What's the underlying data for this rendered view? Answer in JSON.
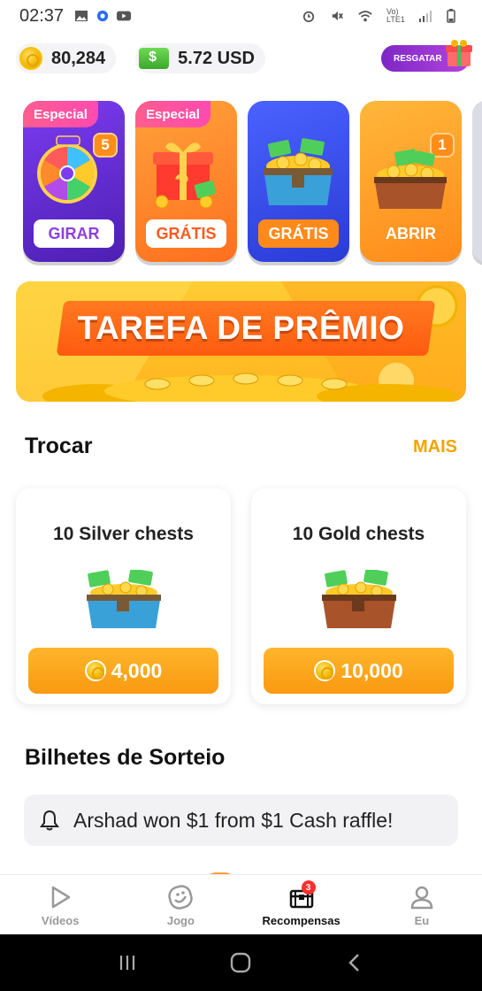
{
  "statusbar": {
    "time": "02:37",
    "network_label": "Vo) LTE1"
  },
  "balances": {
    "coins": "80,284",
    "cash": "5.72 USD",
    "redeem_label": "RESGATAR"
  },
  "reward_cards": [
    {
      "tag": "Especial",
      "badge": "5",
      "button": "GIRAR",
      "icon": "wheel-icon"
    },
    {
      "tag": "Especial",
      "badge": "",
      "button": "GRÁTIS",
      "icon": "gift-box-icon"
    },
    {
      "tag": "",
      "badge": "",
      "button": "GRÁTIS",
      "icon": "silver-chest-icon"
    },
    {
      "tag": "",
      "badge": "1",
      "button": "ABRIR",
      "icon": "gold-chest-icon"
    }
  ],
  "banner": {
    "title": "TAREFA DE PRÊMIO"
  },
  "trade": {
    "title": "Trocar",
    "more": "MAIS",
    "items": [
      {
        "title": "10 Silver chests",
        "price": "4,000",
        "icon": "silver-chest-icon"
      },
      {
        "title": "10 Gold chests",
        "price": "10,000",
        "icon": "gold-chest-icon"
      }
    ]
  },
  "raffle": {
    "title": "Bilhetes de Sorteio",
    "message": "Arshad won $1 from $1 Cash raffle!"
  },
  "bottom_nav": {
    "items": [
      {
        "label": "Vídeos",
        "icon": "play-icon"
      },
      {
        "label": "Jogo",
        "icon": "game-icon"
      },
      {
        "label": "Recompensas",
        "icon": "chest-icon",
        "badge": "3",
        "active": true
      },
      {
        "label": "Eu",
        "icon": "user-icon"
      }
    ]
  },
  "colors": {
    "accent": "#f5a300",
    "purple": "#8e3fe0",
    "orange": "#ff6f1f",
    "blue": "#2a3bd6"
  }
}
